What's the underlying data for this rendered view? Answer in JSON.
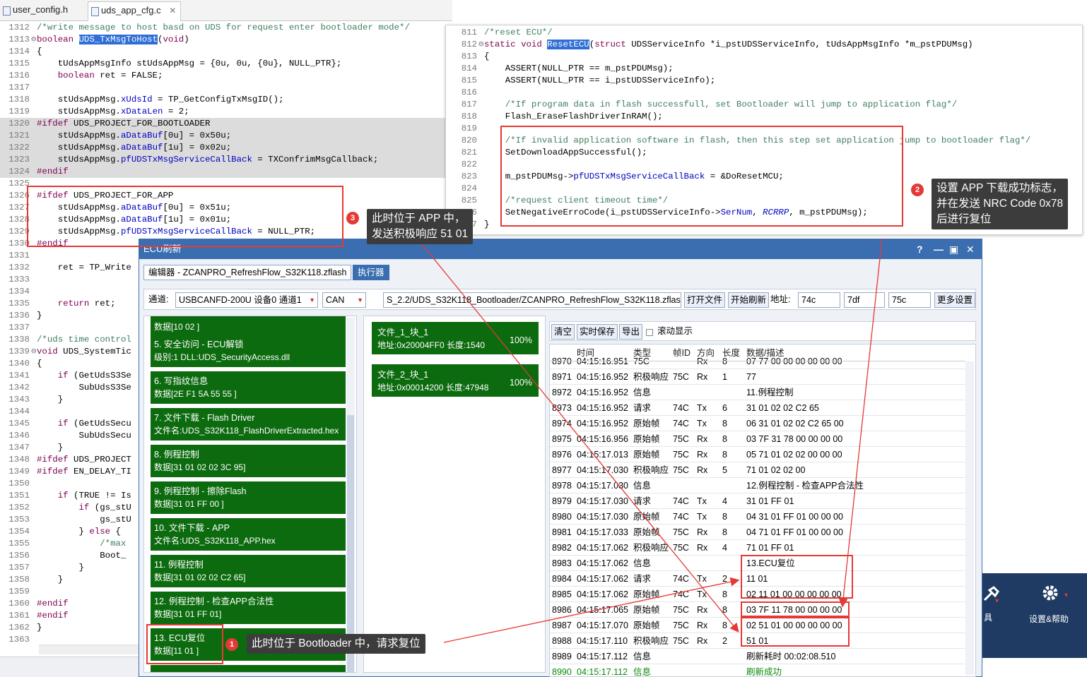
{
  "tabs": [
    {
      "label": "user_config.h"
    },
    {
      "label": "uds_app_cfg.c",
      "close": "✕"
    }
  ],
  "left_code": [
    {
      "n": "1312",
      "t": "/*write message to host basd on UDS for request enter bootloader mode*/",
      "c": "cm"
    },
    {
      "n": "1313",
      "t": "boolean UDS_TxMsgToHost(void)",
      "fold": "⊖"
    },
    {
      "n": "1314",
      "t": "{"
    },
    {
      "n": "1315",
      "t": "    tUdsAppMsgInfo stUdsAppMsg = {0u, 0u, {0u}, NULL_PTR};"
    },
    {
      "n": "1316",
      "t": "    boolean ret = FALSE;"
    },
    {
      "n": "1317",
      "t": ""
    },
    {
      "n": "1318",
      "t": "    stUdsAppMsg.xUdsId = TP_GetConfigTxMsgID();"
    },
    {
      "n": "1319",
      "t": "    stUdsAppMsg.xDataLen = 2;"
    },
    {
      "n": "1320",
      "t": "#ifdef UDS_PROJECT_FOR_BOOTLOADER",
      "g": true
    },
    {
      "n": "1321",
      "t": "    stUdsAppMsg.aDataBuf[0u] = 0x50u;",
      "g": true
    },
    {
      "n": "1322",
      "t": "    stUdsAppMsg.aDataBuf[1u] = 0x02u;",
      "g": true
    },
    {
      "n": "1323",
      "t": "    stUdsAppMsg.pfUDSTxMsgServiceCallBack = TXConfrimMsgCallback;",
      "g": true
    },
    {
      "n": "1324",
      "t": "#endif",
      "g": true
    },
    {
      "n": "1325",
      "t": ""
    },
    {
      "n": "1326",
      "t": "#ifdef UDS_PROJECT_FOR_APP"
    },
    {
      "n": "1327",
      "t": "    stUdsAppMsg.aDataBuf[0u] = 0x51u;"
    },
    {
      "n": "1328",
      "t": "    stUdsAppMsg.aDataBuf[1u] = 0x01u;"
    },
    {
      "n": "1329",
      "t": "    stUdsAppMsg.pfUDSTxMsgServiceCallBack = NULL_PTR;"
    },
    {
      "n": "1330",
      "t": "#endif"
    },
    {
      "n": "1331",
      "t": ""
    },
    {
      "n": "1332",
      "t": "    ret = TP_Write"
    },
    {
      "n": "1333",
      "t": ""
    },
    {
      "n": "1334",
      "t": ""
    },
    {
      "n": "1335",
      "t": "    return ret;"
    },
    {
      "n": "1336",
      "t": "}"
    },
    {
      "n": "1337",
      "t": ""
    },
    {
      "n": "1338",
      "t": "/*uds time control",
      "c": "cm"
    },
    {
      "n": "1339",
      "t": "void UDS_SystemTic",
      "fold": "⊖"
    },
    {
      "n": "1340",
      "t": "{"
    },
    {
      "n": "1341",
      "t": "    if (GetUdsS3Se"
    },
    {
      "n": "1342",
      "t": "        SubUdsS3Se"
    },
    {
      "n": "1343",
      "t": "    }"
    },
    {
      "n": "1344",
      "t": ""
    },
    {
      "n": "1345",
      "t": "    if (GetUdsSecu"
    },
    {
      "n": "1346",
      "t": "        SubUdsSecu"
    },
    {
      "n": "1347",
      "t": "    }"
    },
    {
      "n": "1348",
      "t": "#ifdef UDS_PROJECT"
    },
    {
      "n": "1349",
      "t": "#ifdef EN_DELAY_TI"
    },
    {
      "n": "1350",
      "t": ""
    },
    {
      "n": "1351",
      "t": "    if (TRUE != Is"
    },
    {
      "n": "1352",
      "t": "        if (gs_stU"
    },
    {
      "n": "1353",
      "t": "            gs_stU"
    },
    {
      "n": "1354",
      "t": "        } else {"
    },
    {
      "n": "1355",
      "t": "            /*max",
      "c": "cm"
    },
    {
      "n": "1356",
      "t": "            Boot_"
    },
    {
      "n": "1357",
      "t": "        }"
    },
    {
      "n": "1358",
      "t": "    }"
    },
    {
      "n": "1359",
      "t": ""
    },
    {
      "n": "1360",
      "t": "#endif"
    },
    {
      "n": "1361",
      "t": "#endif"
    },
    {
      "n": "1362",
      "t": "}"
    },
    {
      "n": "1363",
      "t": ""
    }
  ],
  "right_code": [
    {
      "n": "811",
      "t": "/*reset ECU*/",
      "c": "cm"
    },
    {
      "n": "812",
      "t": "static void ResetECU(struct UDSServiceInfo *i_pstUDSServiceInfo, tUdsAppMsgInfo *m_pstPDUMsg)",
      "fold": "⊖"
    },
    {
      "n": "813",
      "t": "{"
    },
    {
      "n": "814",
      "t": "    ASSERT(NULL_PTR == m_pstPDUMsg);"
    },
    {
      "n": "815",
      "t": "    ASSERT(NULL_PTR == i_pstUDSServiceInfo);"
    },
    {
      "n": "816",
      "t": ""
    },
    {
      "n": "817",
      "t": "    /*If program data in flash successfull, set Bootloader will jump to application flag*/",
      "c": "cm"
    },
    {
      "n": "818",
      "t": "    Flash_EraseFlashDriverInRAM();"
    },
    {
      "n": "819",
      "t": ""
    },
    {
      "n": "820",
      "t": "    /*If invalid application software in flash, then this step set application jump to bootloader flag*/",
      "c": "cm"
    },
    {
      "n": "821",
      "t": "    SetDownloadAppSuccessful();"
    },
    {
      "n": "822",
      "t": ""
    },
    {
      "n": "823",
      "t": "    m_pstPDUMsg->pfUDSTxMsgServiceCallBack = &DoResetMCU;"
    },
    {
      "n": "824",
      "t": ""
    },
    {
      "n": "825",
      "t": "    /*request client timeout time*/",
      "c": "cm"
    },
    {
      "n": "826",
      "t": "    SetNegativeErroCode(i_pstUDSServiceInfo->SerNum, RCRRP, m_pstPDUMsg);"
    },
    {
      "n": "827",
      "t": "}"
    }
  ],
  "ecu": {
    "title": "ECU刷新",
    "btn_help": "?",
    "btn_min": "—",
    "btn_max": "▣",
    "btn_close": "✕",
    "tab_editor": "编辑器 - ZCANPRO_RefreshFlow_S32K118.zflash",
    "tab_exec": "执行器",
    "channel_label": "通道:",
    "channel_value": "USBCANFD-200U 设备0 通道1",
    "proto_value": "CAN",
    "file_path": "S_2.2/UDS_S32K118_Bootloader/ZCANPRO_RefreshFlow_S32K118.zflash",
    "btn_open": "打开文件",
    "btn_start": "开始刷新",
    "addr_label": "地址:",
    "addr1": "74c",
    "addr2": "7df",
    "addr3": "75c",
    "btn_more": "更多设置",
    "steps": [
      {
        "l1": "",
        "l2": "数据[10 02 ]"
      },
      {
        "l1": "5. 安全访问 - ECU解锁",
        "l2": "级别:1 DLL:UDS_SecurityAccess.dll"
      },
      {
        "l1": "6. 写指纹信息",
        "l2": "数据[2E F1 5A 55 55 ]"
      },
      {
        "l1": "7. 文件下载 - Flash Driver",
        "l2": "文件名:UDS_S32K118_FlashDriverExtracted.hex"
      },
      {
        "l1": "8. 例程控制",
        "l2": "数据[31 01 02 02 3C 95]"
      },
      {
        "l1": "9. 例程控制 - 擦除Flash",
        "l2": "数据[31 01 FF 00 ]"
      },
      {
        "l1": "10. 文件下载 - APP",
        "l2": "文件名:UDS_S32K118_APP.hex"
      },
      {
        "l1": "11. 例程控制",
        "l2": "数据[31 01 02 02 C2 65]"
      },
      {
        "l1": "12. 例程控制 - 检查APP合法性",
        "l2": "数据[31 01 FF 01]"
      },
      {
        "l1": "13. ECU复位",
        "l2": "数据[11 01 ]"
      },
      {
        "l1": "",
        "l2": ""
      }
    ],
    "files": [
      {
        "name": "文件_1_块_1",
        "info": "地址:0x20004FF0 长度:1540",
        "pct": "100%"
      },
      {
        "name": "文件_2_块_1",
        "info": "地址:0x00014200 长度:47948",
        "pct": "100%"
      }
    ],
    "log_buttons": {
      "clear": "清空",
      "save": "实时保存",
      "export": "导出",
      "scroll": "滚动显示"
    },
    "log_headers": {
      "time": "时间",
      "type": "类型",
      "id": "帧ID",
      "dir": "方向",
      "len": "长度",
      "data": "数据/描述"
    },
    "log_rows": [
      {
        "n": "8970",
        "t": "04:15:16.951",
        "ty": "75C",
        "id": "",
        "d": "Rx",
        "l": "8",
        "v": "07 77 00 00 00 00 00 00"
      },
      {
        "n": "8971",
        "t": "04:15:16.952",
        "ty": "积极响应",
        "id": "75C",
        "d": "Rx",
        "l": "1",
        "v": "77"
      },
      {
        "n": "8972",
        "t": "04:15:16.952",
        "ty": "信息",
        "id": "",
        "d": "",
        "l": "",
        "v": "11.例程控制"
      },
      {
        "n": "8973",
        "t": "04:15:16.952",
        "ty": "请求",
        "id": "74C",
        "d": "Tx",
        "l": "6",
        "v": "31 01 02 02 C2 65"
      },
      {
        "n": "8974",
        "t": "04:15:16.952",
        "ty": "原始帧",
        "id": "74C",
        "d": "Tx",
        "l": "8",
        "v": "06 31 01 02 02 C2 65 00"
      },
      {
        "n": "8975",
        "t": "04:15:16.956",
        "ty": "原始帧",
        "id": "75C",
        "d": "Rx",
        "l": "8",
        "v": "03 7F 31 78 00 00 00 00"
      },
      {
        "n": "8976",
        "t": "04:15:17.013",
        "ty": "原始帧",
        "id": "75C",
        "d": "Rx",
        "l": "8",
        "v": "05 71 01 02 02 00 00 00"
      },
      {
        "n": "8977",
        "t": "04:15:17.030",
        "ty": "积极响应",
        "id": "75C",
        "d": "Rx",
        "l": "5",
        "v": "71 01 02 02 00"
      },
      {
        "n": "8978",
        "t": "04:15:17.030",
        "ty": "信息",
        "id": "",
        "d": "",
        "l": "",
        "v": "12.例程控制 - 检查APP合法性"
      },
      {
        "n": "8979",
        "t": "04:15:17.030",
        "ty": "请求",
        "id": "74C",
        "d": "Tx",
        "l": "4",
        "v": "31 01 FF 01"
      },
      {
        "n": "8980",
        "t": "04:15:17.030",
        "ty": "原始帧",
        "id": "74C",
        "d": "Tx",
        "l": "8",
        "v": "04 31 01 FF 01 00 00 00"
      },
      {
        "n": "8981",
        "t": "04:15:17.033",
        "ty": "原始帧",
        "id": "75C",
        "d": "Rx",
        "l": "8",
        "v": "04 71 01 FF 01 00 00 00"
      },
      {
        "n": "8982",
        "t": "04:15:17.062",
        "ty": "积极响应",
        "id": "75C",
        "d": "Rx",
        "l": "4",
        "v": "71 01 FF 01"
      },
      {
        "n": "8983",
        "t": "04:15:17.062",
        "ty": "信息",
        "id": "",
        "d": "",
        "l": "",
        "v": "13.ECU复位"
      },
      {
        "n": "8984",
        "t": "04:15:17.062",
        "ty": "请求",
        "id": "74C",
        "d": "Tx",
        "l": "2",
        "v": "11 01"
      },
      {
        "n": "8985",
        "t": "04:15:17.062",
        "ty": "原始帧",
        "id": "74C",
        "d": "Tx",
        "l": "8",
        "v": "02 11 01 00 00 00 00 00"
      },
      {
        "n": "8986",
        "t": "04:15:17.065",
        "ty": "原始帧",
        "id": "75C",
        "d": "Rx",
        "l": "8",
        "v": "03 7F 11 78 00 00 00 00"
      },
      {
        "n": "8987",
        "t": "04:15:17.070",
        "ty": "原始帧",
        "id": "75C",
        "d": "Rx",
        "l": "8",
        "v": "02 51 01 00 00 00 00 00"
      },
      {
        "n": "8988",
        "t": "04:15:17.110",
        "ty": "积极响应",
        "id": "75C",
        "d": "Rx",
        "l": "2",
        "v": "51 01"
      },
      {
        "n": "8989",
        "t": "04:15:17.112",
        "ty": "信息",
        "id": "",
        "d": "",
        "l": "",
        "v": "刷新耗时 00:02:08.510"
      },
      {
        "n": "8990",
        "t": "04:15:17.112",
        "ty": "信息",
        "id": "",
        "d": "",
        "l": "",
        "v": "刷新成功",
        "green": true
      }
    ]
  },
  "callouts": {
    "c1": "此时位于 Bootloader 中，请求复位",
    "c2_l1": "设置 APP 下载成功标志，",
    "c2_l2": "并在发送 NRC Code 0x78",
    "c2_l3": "后进行复位",
    "c3_l1": "此时位于 APP 中，",
    "c3_l2": "发送积极响应 51 01",
    "b1": "1",
    "b2": "2",
    "b3": "3"
  },
  "right_toolbar": {
    "label_partial": "具",
    "settings": "设置&帮助"
  },
  "colors": {
    "accent": "#3a6eb0",
    "step_green": "#0d6b0f",
    "annotation_red": "#e53935"
  }
}
